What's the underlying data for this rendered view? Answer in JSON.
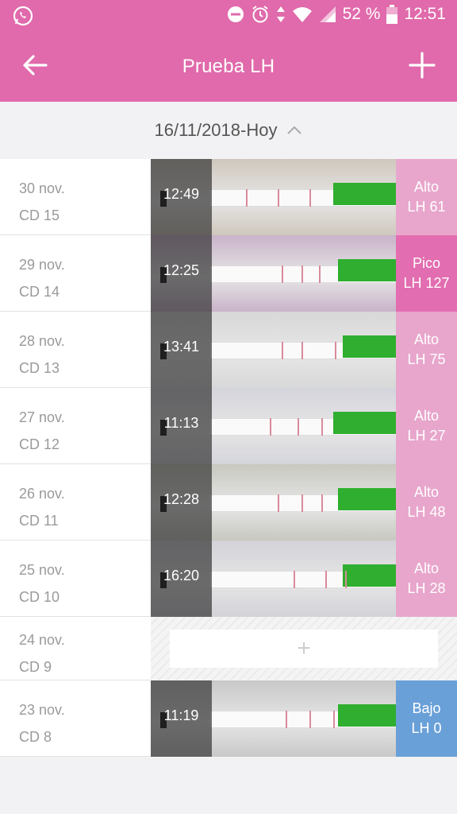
{
  "status_bar": {
    "app_icon": "whatsapp-icon",
    "battery_text": "52 %",
    "time": "12:51",
    "icons": [
      "dnd-icon",
      "alarm-icon",
      "data-arrows-icon",
      "wifi-icon",
      "signal-icon",
      "battery-icon"
    ]
  },
  "app_bar": {
    "title": "Prueba LH",
    "back_icon": "arrow-left-icon",
    "add_icon": "plus-icon"
  },
  "date_range": {
    "label": "16/11/2018-Hoy",
    "toggle_icon": "chevron-up-icon"
  },
  "colors": {
    "brand": "#e06aab",
    "alto": "#e8a6cc",
    "pico": "#e26db0",
    "bajo": "#6aa0d8"
  },
  "entries": [
    {
      "date": "30 nov.",
      "cd": "CD 15",
      "time": "12:49",
      "level": "Alto",
      "value": "LH 61",
      "color": "#e8a6cc",
      "lines": [
        120,
        160,
        200
      ]
    },
    {
      "date": "29 nov.",
      "cd": "CD 14",
      "time": "12:25",
      "level": "Pico",
      "value": "LH 127",
      "color": "#e26db0",
      "lines": [
        165,
        190,
        212
      ]
    },
    {
      "date": "28 nov.",
      "cd": "CD 13",
      "time": "13:41",
      "level": "Alto",
      "value": "LH 75",
      "color": "#e8a6cc",
      "lines": [
        165,
        190,
        232
      ]
    },
    {
      "date": "27 nov.",
      "cd": "CD 12",
      "time": "11:13",
      "level": "Alto",
      "value": "LH 27",
      "color": "#e8a6cc",
      "lines": [
        150,
        185,
        215
      ]
    },
    {
      "date": "26 nov.",
      "cd": "CD 11",
      "time": "12:28",
      "level": "Alto",
      "value": "LH 48",
      "color": "#e8a6cc",
      "lines": [
        160,
        190,
        215
      ]
    },
    {
      "date": "25 nov.",
      "cd": "CD 10",
      "time": "16:20",
      "level": "Alto",
      "value": "LH 28",
      "color": "#e8a6cc",
      "lines": [
        180,
        220,
        245
      ]
    },
    {
      "date": "24 nov.",
      "cd": "CD 9",
      "empty": true,
      "add_label": "+"
    },
    {
      "date": "23 nov.",
      "cd": "CD 8",
      "time": "11:19",
      "level": "Bajo",
      "value": "LH 0",
      "color": "#6aa0d8",
      "lines": [
        170,
        200,
        230
      ]
    }
  ]
}
